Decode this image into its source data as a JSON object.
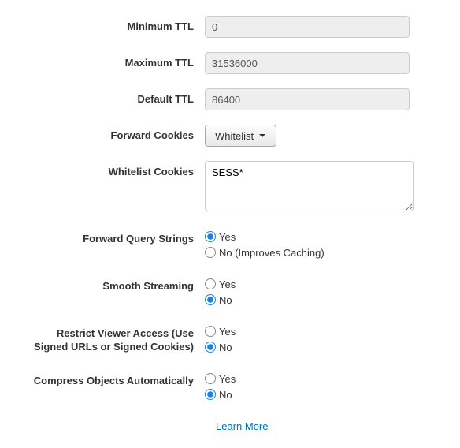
{
  "fields": {
    "min_ttl": {
      "label": "Minimum TTL",
      "value": "0"
    },
    "max_ttl": {
      "label": "Maximum TTL",
      "value": "31536000"
    },
    "default_ttl": {
      "label": "Default TTL",
      "value": "86400"
    },
    "forward_cookies": {
      "label": "Forward Cookies",
      "selected": "Whitelist"
    },
    "whitelist_cookies": {
      "label": "Whitelist Cookies",
      "value": "SESS*"
    },
    "forward_query": {
      "label": "Forward Query Strings",
      "options": {
        "yes": "Yes",
        "no": "No (Improves Caching)"
      },
      "selected": "yes"
    },
    "smooth_streaming": {
      "label": "Smooth Streaming",
      "options": {
        "yes": "Yes",
        "no": "No"
      },
      "selected": "no"
    },
    "restrict_viewer": {
      "label": "Restrict Viewer Access (Use Signed URLs or Signed Cookies)",
      "options": {
        "yes": "Yes",
        "no": "No"
      },
      "selected": "no"
    },
    "compress": {
      "label": "Compress Objects Automatically",
      "options": {
        "yes": "Yes",
        "no": "No"
      },
      "selected": "no"
    }
  },
  "links": {
    "learn_more": "Learn More"
  }
}
